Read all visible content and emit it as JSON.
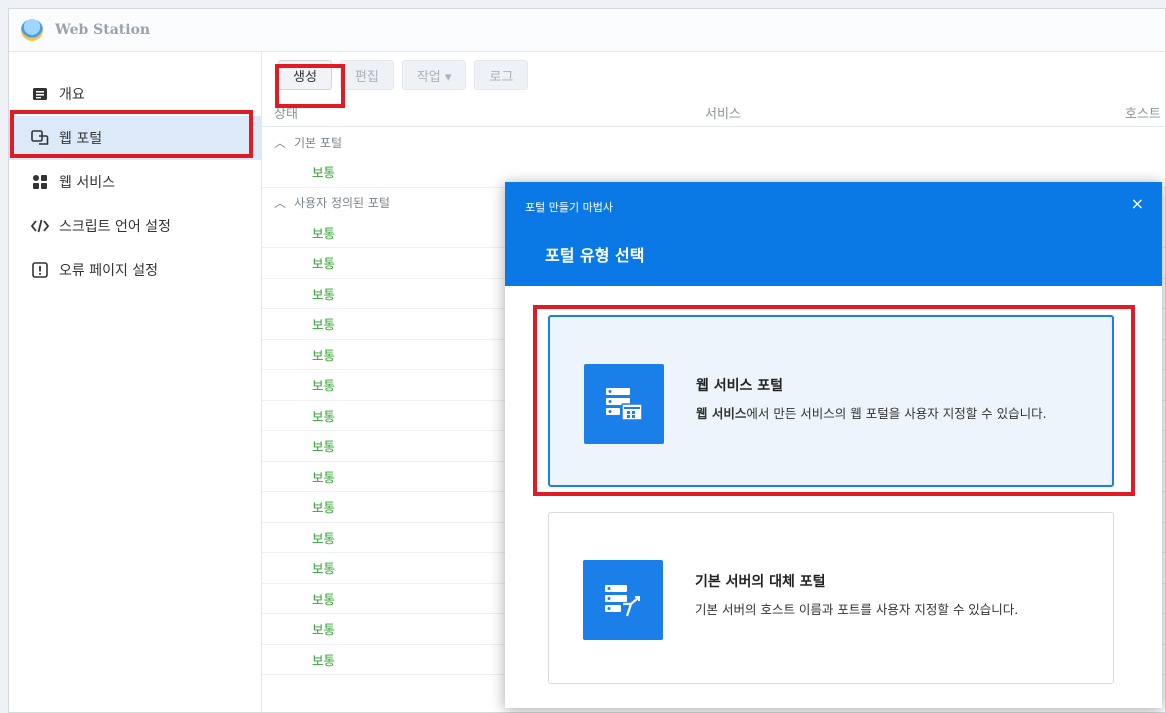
{
  "app": {
    "title": "Web Station"
  },
  "sidebar": {
    "items": [
      {
        "label": "개요",
        "icon": "overview-icon"
      },
      {
        "label": "웹 포털",
        "icon": "web-portal-icon"
      },
      {
        "label": "웹 서비스",
        "icon": "web-service-icon"
      },
      {
        "label": "스크립트 언어 설정",
        "icon": "code-icon"
      },
      {
        "label": "오류 페이지 설정",
        "icon": "error-page-icon"
      }
    ]
  },
  "toolbar": {
    "create": "생성",
    "edit": "편집",
    "action": "작업 ▾",
    "log": "로그"
  },
  "table": {
    "columns": [
      "상태",
      "서비스",
      "호스트"
    ],
    "group1": "기본 포털",
    "group2": "사용자 정의된 포털",
    "status": "보통"
  },
  "dialog": {
    "wizard_title": "포털 만들기 마법사",
    "close": "×",
    "title": "포털 유형 선택",
    "option1": {
      "title": "웹 서비스 포털",
      "desc_bold": "웹 서비스",
      "desc_rest": "에서 만든 서비스의 웹 포털을 사용자 지정할 수 있습니다."
    },
    "option2": {
      "title": "기본 서버의 대체 포털",
      "desc": "기본 서버의 호스트 이름과 포트를 사용자 지정할 수 있습니다."
    }
  },
  "colors": {
    "accent": "#0b79e5",
    "highlight": "#e01b24",
    "status_green": "#2ea12e"
  }
}
